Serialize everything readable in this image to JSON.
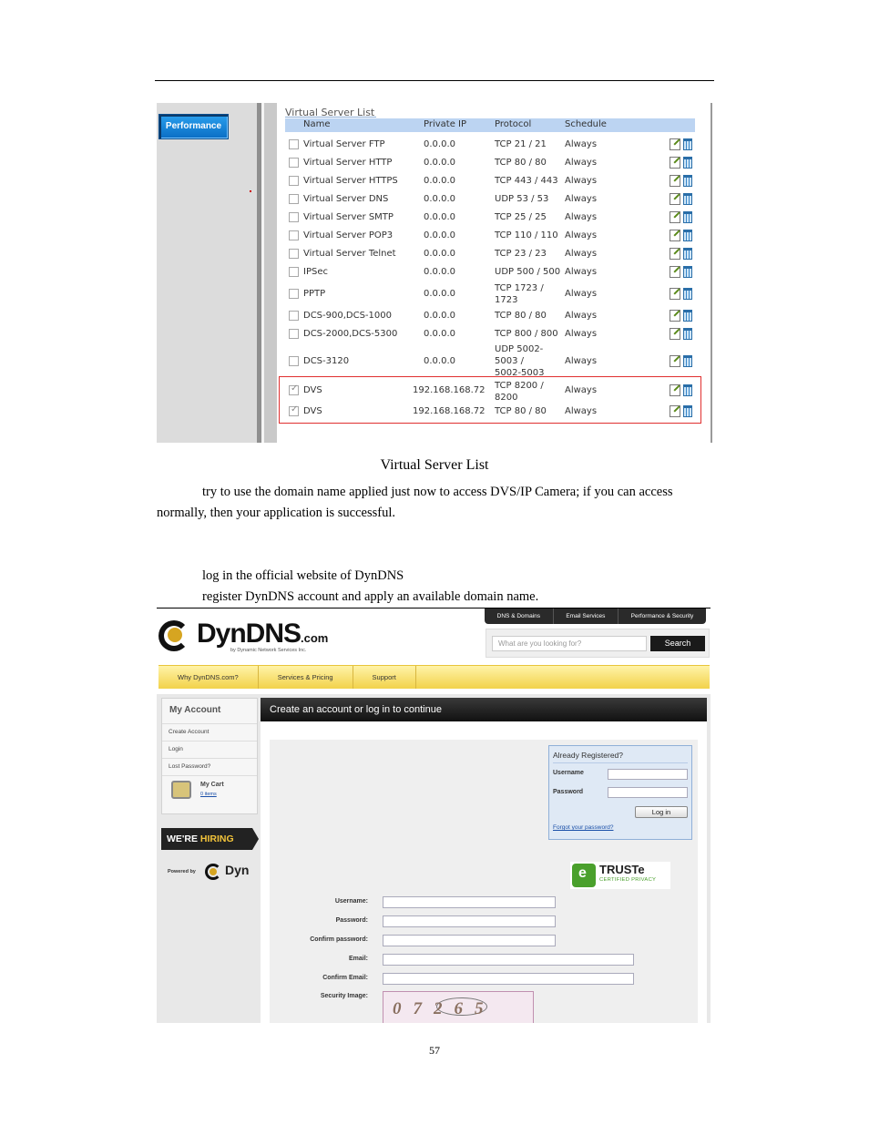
{
  "virtual_server_list": {
    "left_panel_button": "Performance",
    "title": "Virtual Server List",
    "columns": [
      "Name",
      "Private IP",
      "Protocol",
      "Schedule"
    ],
    "rows": [
      {
        "name": "Virtual Server FTP",
        "ip": "0.0.0.0",
        "protocol": "TCP 21 / 21",
        "schedule": "Always",
        "checked": false
      },
      {
        "name": "Virtual Server HTTP",
        "ip": "0.0.0.0",
        "protocol": "TCP 80 / 80",
        "schedule": "Always",
        "checked": false
      },
      {
        "name": "Virtual Server HTTPS",
        "ip": "0.0.0.0",
        "protocol": "TCP 443 / 443",
        "schedule": "Always",
        "checked": false
      },
      {
        "name": "Virtual Server DNS",
        "ip": "0.0.0.0",
        "protocol": "UDP 53 / 53",
        "schedule": "Always",
        "checked": false
      },
      {
        "name": "Virtual Server SMTP",
        "ip": "0.0.0.0",
        "protocol": "TCP 25 / 25",
        "schedule": "Always",
        "checked": false
      },
      {
        "name": "Virtual Server POP3",
        "ip": "0.0.0.0",
        "protocol": "TCP 110 / 110",
        "schedule": "Always",
        "checked": false
      },
      {
        "name": "Virtual Server Telnet",
        "ip": "0.0.0.0",
        "protocol": "TCP 23 / 23",
        "schedule": "Always",
        "checked": false
      },
      {
        "name": "IPSec",
        "ip": "0.0.0.0",
        "protocol": "UDP 500 / 500",
        "schedule": "Always",
        "checked": false
      },
      {
        "name": "PPTP",
        "ip": "0.0.0.0",
        "protocol": "TCP 1723 / 1723",
        "schedule": "Always",
        "checked": false
      },
      {
        "name": "DCS-900,DCS-1000",
        "ip": "0.0.0.0",
        "protocol": "TCP 80 / 80",
        "schedule": "Always",
        "checked": false
      },
      {
        "name": "DCS-2000,DCS-5300",
        "ip": "0.0.0.0",
        "protocol": "TCP 800 / 800",
        "schedule": "Always",
        "checked": false
      },
      {
        "name": "DCS-3120",
        "ip": "0.0.0.0",
        "protocol": "UDP 5002-5003 / 5002-5003",
        "schedule": "Always",
        "checked": false
      },
      {
        "name": "DVS",
        "ip": "192.168.168.72",
        "protocol": "TCP 8200 / 8200",
        "schedule": "Always",
        "checked": true
      },
      {
        "name": "DVS",
        "ip": "192.168.168.72",
        "protocol": "TCP 80 / 80",
        "schedule": "Always",
        "checked": true
      }
    ]
  },
  "caption_1": "Virtual Server List",
  "paragraph_1_line_1": "try to use the domain name applied just now to access DVS/IP Camera; if you can access",
  "paragraph_1_line_2": "normally, then your application is successful.",
  "step_1": "log in the official website of DynDNS",
  "step_2": "register DynDNS account and apply an available domain name.",
  "dyndns": {
    "top_tabs": [
      "DNS & Domains",
      "Email Services",
      "Performance & Security"
    ],
    "logo_text": "DynDNS",
    "logo_suffix": ".com",
    "logo_tagline": "by Dynamic Network Services Inc.",
    "search_placeholder": "What are you looking for?",
    "search_button": "Search",
    "nav": [
      "Why DynDNS.com?",
      "Services & Pricing",
      "Support"
    ],
    "sidebar": {
      "title": "My Account",
      "links": [
        "Create Account",
        "Login",
        "Lost Password?"
      ],
      "cart_label": "My Cart",
      "cart_items": "0 items"
    },
    "hiring": {
      "prefix": "WE'RE ",
      "accent": "HIRING"
    },
    "powered_by": "Powered by",
    "powered_brand": "Dyn",
    "main_header": "Create an account or log in to continue",
    "login_box": {
      "title": "Already Registered?",
      "username_label": "Username",
      "password_label": "Password",
      "login_button": "Log in",
      "forgot_link": "Forgot your password?"
    },
    "truste": {
      "name": "TRUSTe",
      "sub": "CERTIFIED PRIVACY"
    },
    "register_fields": [
      "Username:",
      "Password:",
      "Confirm password:",
      "Email:",
      "Confirm Email:",
      "Security Image:"
    ],
    "captcha_text": "07265"
  },
  "page_number": "57"
}
